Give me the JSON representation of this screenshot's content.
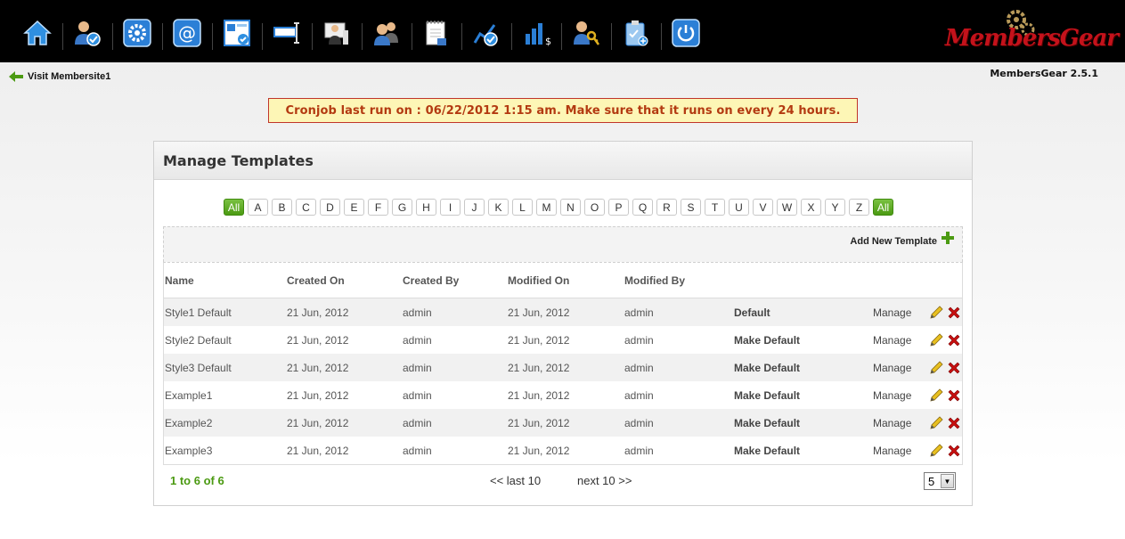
{
  "app": {
    "logo_text": "MembersGear",
    "version": "MembersGear 2.5.1"
  },
  "toolbar": {
    "icons": [
      "home-icon",
      "users-check-icon",
      "settings-gear-icon",
      "email-icon",
      "window-check-icon",
      "text-field-icon",
      "desktop-user-icon",
      "members-icon",
      "notepad-icon",
      "chart-check-icon",
      "finance-chart-icon",
      "user-key-icon",
      "clipboard-add-icon",
      "power-icon"
    ]
  },
  "nav": {
    "visit_link": "Visit Membersite1"
  },
  "notice": {
    "cron": "Cronjob last run on : 06/22/2012 1:15 am. Make sure that it runs on every 24 hours."
  },
  "panel": {
    "title": "Manage Templates",
    "add_template": "Add New Template",
    "alphabet": [
      "All",
      "A",
      "B",
      "C",
      "D",
      "E",
      "F",
      "G",
      "H",
      "I",
      "J",
      "K",
      "L",
      "M",
      "N",
      "O",
      "P",
      "Q",
      "R",
      "S",
      "T",
      "U",
      "V",
      "W",
      "X",
      "Y",
      "Z",
      "All"
    ]
  },
  "table": {
    "headers": {
      "name": "Name",
      "created_on": "Created On",
      "created_by": "Created By",
      "modified_on": "Modified On",
      "modified_by": "Modified By"
    },
    "rows": [
      {
        "name": "Style1 Default",
        "created_on": "21 Jun, 2012",
        "created_by": "admin",
        "modified_on": "21 Jun, 2012",
        "modified_by": "admin",
        "default": "Default",
        "manage": "Manage"
      },
      {
        "name": "Style2 Default",
        "created_on": "21 Jun, 2012",
        "created_by": "admin",
        "modified_on": "21 Jun, 2012",
        "modified_by": "admin",
        "default": "Make Default",
        "manage": "Manage"
      },
      {
        "name": "Style3 Default",
        "created_on": "21 Jun, 2012",
        "created_by": "admin",
        "modified_on": "21 Jun, 2012",
        "modified_by": "admin",
        "default": "Make Default",
        "manage": "Manage"
      },
      {
        "name": "Example1",
        "created_on": "21 Jun, 2012",
        "created_by": "admin",
        "modified_on": "21 Jun, 2012",
        "modified_by": "admin",
        "default": "Make Default",
        "manage": "Manage"
      },
      {
        "name": "Example2",
        "created_on": "21 Jun, 2012",
        "created_by": "admin",
        "modified_on": "21 Jun, 2012",
        "modified_by": "admin",
        "default": "Make Default",
        "manage": "Manage"
      },
      {
        "name": "Example3",
        "created_on": "21 Jun, 2012",
        "created_by": "admin",
        "modified_on": "21 Jun, 2012",
        "modified_by": "admin",
        "default": "Make Default",
        "manage": "Manage"
      }
    ]
  },
  "pagination": {
    "count": "1 to 6 of 6",
    "prev": "<< last 10",
    "next": "next 10 >>",
    "per_page": "5"
  },
  "colors": {
    "accent_green": "#4b9a12",
    "notice_border": "#c0352a",
    "notice_bg": "#fdf6b6",
    "logo_red": "#c4121b"
  }
}
